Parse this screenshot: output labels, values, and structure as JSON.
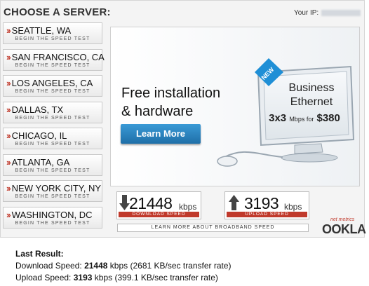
{
  "choose_label": "CHOOSE A SERVER:",
  "begin_label": "BEGIN THE SPEED TEST",
  "servers": [
    {
      "city": "SEATTLE, WA"
    },
    {
      "city": "SAN FRANCISCO, CA"
    },
    {
      "city": "LOS ANGELES, CA"
    },
    {
      "city": "DALLAS, TX"
    },
    {
      "city": "CHICAGO, IL"
    },
    {
      "city": "ATLANTA, GA"
    },
    {
      "city": "NEW YORK CITY, NY"
    },
    {
      "city": "WASHINGTON, DC"
    }
  ],
  "ip_label": "Your IP:",
  "ad": {
    "line1": "Free installation",
    "line2": "& hardware",
    "button": "Learn More",
    "badge": "NEW",
    "monitor_line1": "Business",
    "monitor_line2": "Ethernet",
    "offer_size": "3x3",
    "offer_mid": "Mbps for",
    "offer_price": "$380"
  },
  "download": {
    "value": "21448",
    "unit": "kbps",
    "label": "DOWNLOAD SPEED"
  },
  "upload": {
    "value": "3193",
    "unit": "kbps",
    "label": "UPLOAD SPEED"
  },
  "learn_broadband": "LEARN MORE ABOUT BROADBAND SPEED",
  "brand": {
    "net_metrics": "net metrics",
    "name": "OOKLA"
  },
  "last_result": {
    "title": "Last Result:",
    "download_prefix": "Download Speed:",
    "download_value": "21448",
    "download_suffix": "kbps (2681 KB/sec transfer rate)",
    "upload_prefix": "Upload Speed:",
    "upload_value": "3193",
    "upload_suffix": "kbps (399.1 KB/sec transfer rate)"
  },
  "colors": {
    "accent_red": "#c0392b",
    "button_blue": "#2a86c4"
  }
}
